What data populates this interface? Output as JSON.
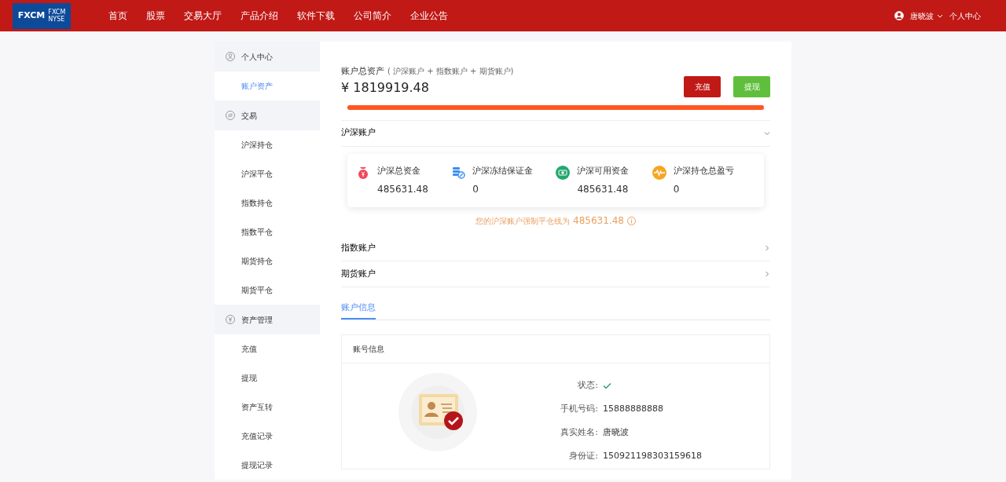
{
  "navbar": {
    "logo": {
      "text": "FXCM",
      "sub": [
        "FXCM",
        "NYSE"
      ]
    },
    "links": [
      "首页",
      "股票",
      "交易大厅",
      "产品介绍",
      "软件下载",
      "公司简介",
      "企业公告"
    ],
    "user": "唐晓波",
    "user_menu": "个人中心"
  },
  "sidebar": {
    "groups": [
      {
        "title": "个人中心",
        "items": [
          {
            "label": "账户资产",
            "selected": true
          }
        ]
      },
      {
        "title": "交易",
        "items": [
          {
            "label": "沪深持仓",
            "selected": false
          },
          {
            "label": "沪深平仓",
            "selected": false
          },
          {
            "label": "指数持仓",
            "selected": false
          },
          {
            "label": "指数平仓",
            "selected": false
          },
          {
            "label": "期货持仓",
            "selected": false
          },
          {
            "label": "期货平仓",
            "selected": false
          }
        ]
      },
      {
        "title": "资产管理",
        "items": [
          {
            "label": "充值",
            "selected": false
          },
          {
            "label": "提现",
            "selected": false
          },
          {
            "label": "资产互转",
            "selected": false
          },
          {
            "label": "充值记录",
            "selected": false
          },
          {
            "label": "提现记录",
            "selected": false
          }
        ]
      }
    ]
  },
  "assets": {
    "title": "账户总资产",
    "note": "( 沪深账户 + 指数账户 + 期货账户)",
    "total": "¥ 1819919.48",
    "buttons": [
      {
        "label": "充值",
        "kind": "primary"
      },
      {
        "label": "提现",
        "kind": "success"
      }
    ],
    "progress": {
      "level": 1
    }
  },
  "accounts": [
    {
      "title": "沪深账户",
      "expanded": true,
      "stats": [
        {
          "label": "沪深总资金",
          "value": "485631.48"
        },
        {
          "label": "沪深冻结保证金",
          "value": "0"
        },
        {
          "label": "沪深可用资金",
          "value": "485631.48"
        },
        {
          "label": "沪深持仓总盈亏",
          "value": "0"
        }
      ],
      "hint": "您的沪深账户强制平仓线为",
      "hint_value": "485631.48"
    },
    {
      "title": "指数账户",
      "expanded": false
    },
    {
      "title": "期货账户",
      "expanded": false
    }
  ],
  "tabs": [
    {
      "label": "账户信息",
      "selected": true
    }
  ],
  "account_info": {
    "title": "账号信息",
    "fields": [
      {
        "label": "状态:",
        "kind": "check",
        "verified": true
      },
      {
        "label": "手机号码:",
        "value": "15888888888",
        "kind": "text"
      },
      {
        "label": "真实姓名:",
        "value": "唐晓波",
        "kind": "text"
      },
      {
        "label": "身份证:",
        "value": "150921198303159618",
        "kind": "text"
      }
    ]
  }
}
